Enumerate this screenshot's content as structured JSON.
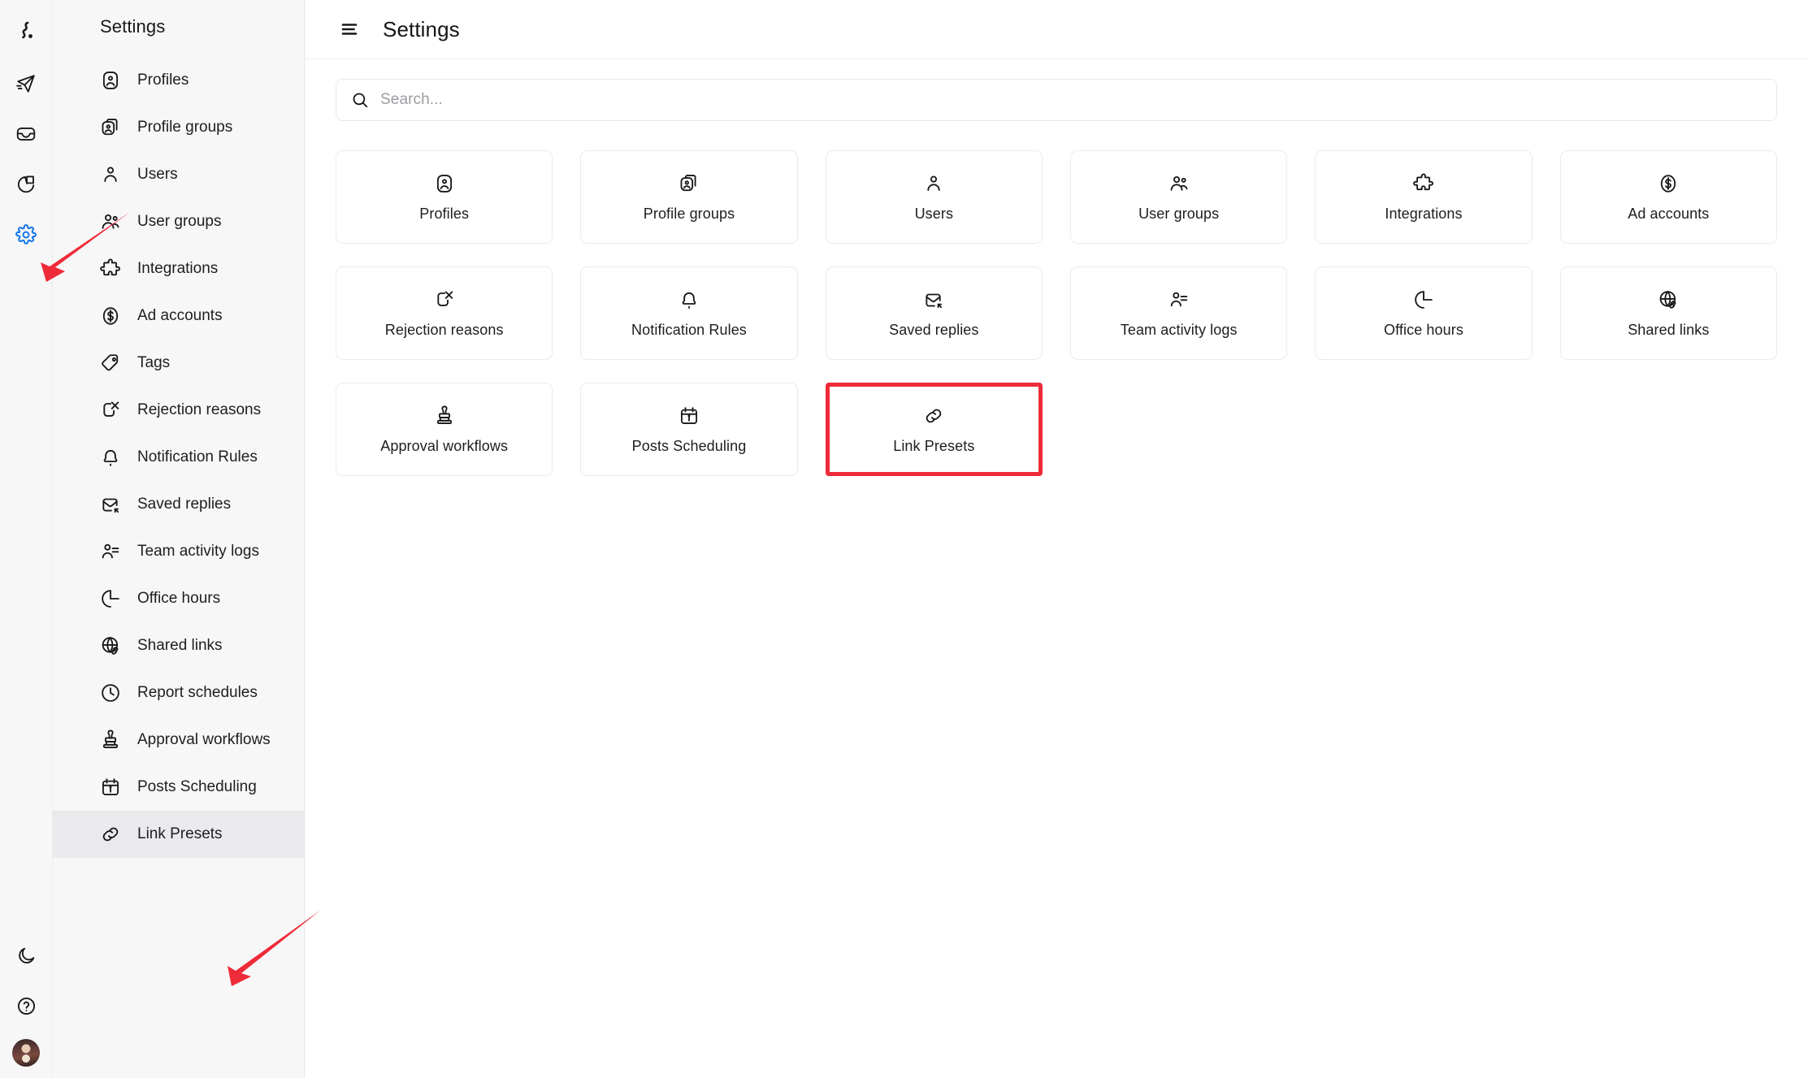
{
  "app": {
    "logo": "brand-squiggle-logo",
    "accent_blue": "#1877e8",
    "annotation_red": "#ee2b38",
    "sidebar_bg": "#f7f7f8",
    "selected_bg": "#eaeaec"
  },
  "rail": {
    "items": [
      {
        "name": "publish-icon",
        "title": "Publish"
      },
      {
        "name": "inbox-icon",
        "title": "Inbox"
      },
      {
        "name": "analytics-icon",
        "title": "Analytics"
      },
      {
        "name": "settings-gear-icon",
        "title": "Settings",
        "active": true
      }
    ],
    "bottom": [
      {
        "name": "dark-mode-moon-icon",
        "title": "Dark mode"
      },
      {
        "name": "help-question-icon",
        "title": "Help"
      },
      {
        "name": "user-avatar",
        "title": "Account"
      }
    ]
  },
  "sidebar": {
    "title": "Settings",
    "selected": "Link Presets",
    "items": [
      {
        "label": "Profiles",
        "icon": "profile-badge-icon"
      },
      {
        "label": "Profile groups",
        "icon": "profile-group-icon"
      },
      {
        "label": "Users",
        "icon": "user-icon"
      },
      {
        "label": "User groups",
        "icon": "user-group-icon"
      },
      {
        "label": "Integrations",
        "icon": "puzzle-piece-icon"
      },
      {
        "label": "Ad accounts",
        "icon": "dollar-coin-icon"
      },
      {
        "label": "Tags",
        "icon": "tag-icon"
      },
      {
        "label": "Rejection reasons",
        "icon": "reject-x-icon"
      },
      {
        "label": "Notification Rules",
        "icon": "bell-icon"
      },
      {
        "label": "Saved replies",
        "icon": "saved-reply-icon"
      },
      {
        "label": "Team activity logs",
        "icon": "activity-log-icon"
      },
      {
        "label": "Office hours",
        "icon": "moon-clock-icon"
      },
      {
        "label": "Shared links",
        "icon": "globe-link-icon"
      },
      {
        "label": "Report schedules",
        "icon": "clock-icon"
      },
      {
        "label": "Approval workflows",
        "icon": "stamp-icon"
      },
      {
        "label": "Posts Scheduling",
        "icon": "calendar-icon"
      },
      {
        "label": "Link Presets",
        "icon": "link-chain-icon"
      }
    ]
  },
  "header": {
    "menu_icon": "hamburger-menu-icon",
    "title": "Settings"
  },
  "search": {
    "icon": "search-icon",
    "placeholder": "Search...",
    "value": ""
  },
  "cards": [
    {
      "label": "Profiles",
      "icon": "profile-badge-icon",
      "highlight": false
    },
    {
      "label": "Profile groups",
      "icon": "profile-group-icon",
      "highlight": false
    },
    {
      "label": "Users",
      "icon": "user-icon",
      "highlight": false
    },
    {
      "label": "User groups",
      "icon": "user-group-icon",
      "highlight": false
    },
    {
      "label": "Integrations",
      "icon": "puzzle-piece-icon",
      "highlight": false
    },
    {
      "label": "Ad accounts",
      "icon": "dollar-coin-icon",
      "highlight": false
    },
    {
      "label": "Rejection reasons",
      "icon": "reject-x-icon",
      "highlight": false
    },
    {
      "label": "Notification Rules",
      "icon": "bell-icon",
      "highlight": false
    },
    {
      "label": "Saved replies",
      "icon": "saved-reply-icon",
      "highlight": false
    },
    {
      "label": "Team activity logs",
      "icon": "activity-log-icon",
      "highlight": false
    },
    {
      "label": "Office hours",
      "icon": "moon-clock-icon",
      "highlight": false
    },
    {
      "label": "Shared links",
      "icon": "globe-link-icon",
      "highlight": false
    },
    {
      "label": "Approval workflows",
      "icon": "stamp-icon",
      "highlight": false
    },
    {
      "label": "Posts Scheduling",
      "icon": "calendar-icon",
      "highlight": false
    },
    {
      "label": "Link Presets",
      "icon": "link-chain-icon",
      "highlight": true
    }
  ],
  "annotations": [
    {
      "name": "arrow-to-settings-gear",
      "target": "settings-gear-icon"
    },
    {
      "name": "arrow-to-link-presets",
      "target": "sidebar-item-link-presets"
    },
    {
      "name": "box-around-link-presets-card",
      "target": "card-link-presets"
    }
  ]
}
